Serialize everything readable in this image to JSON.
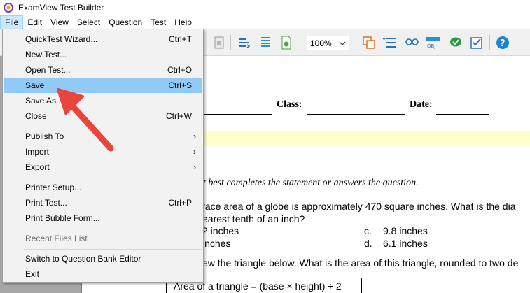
{
  "window": {
    "title": "ExamView Test Builder"
  },
  "menubar": {
    "items": [
      {
        "label": "File"
      },
      {
        "label": "Edit"
      },
      {
        "label": "View"
      },
      {
        "label": "Select"
      },
      {
        "label": "Question"
      },
      {
        "label": "Test"
      },
      {
        "label": "Help"
      }
    ]
  },
  "toolbar": {
    "zoom_value": "100%"
  },
  "file_menu": {
    "items": [
      {
        "label": "QuickTest Wizard...",
        "shortcut": "Ctrl+T"
      },
      {
        "label": "New Test...",
        "shortcut": ""
      },
      {
        "label": "Open Test...",
        "shortcut": "Ctrl+O"
      },
      {
        "label": "Save",
        "shortcut": "Ctrl+S"
      },
      {
        "label": "Save As...",
        "shortcut": ""
      },
      {
        "label": "Close",
        "shortcut": "Ctrl+W"
      },
      {
        "label": "Publish To",
        "shortcut": ""
      },
      {
        "label": "Import",
        "shortcut": ""
      },
      {
        "label": "Export",
        "shortcut": ""
      },
      {
        "label": "Printer Setup...",
        "shortcut": ""
      },
      {
        "label": "Print Test...",
        "shortcut": "Ctrl+P"
      },
      {
        "label": "Print Bubble Form...",
        "shortcut": ""
      },
      {
        "label": "Recent Files List",
        "shortcut": ""
      },
      {
        "label": "Switch to Question Bank Editor",
        "shortcut": ""
      },
      {
        "label": "Exit",
        "shortcut": ""
      }
    ],
    "submenu_arrow": "›"
  },
  "document": {
    "class_label": "Class:",
    "date_label": "Date:",
    "instructions": "at best completes the statement or answers the question.",
    "q1_line1": "face area of a globe is approximately 470 square inches. What is the dia",
    "q1_line2": "earest tenth of an inch?",
    "answers": {
      "a": "2 inches",
      "b": "inches",
      "c_letter": "c.",
      "c_text": "9.8 inches",
      "d_letter": "d.",
      "d_text": "6.1 inches"
    },
    "q2_text": "ew the triangle below. What is the area of this triangle, rounded to two de",
    "formula": "Area of a triangle = (base × height) ÷ 2"
  },
  "colors": {
    "menu_highlight": "#91c9f7",
    "annotation_arrow": "#e8453c",
    "highlight_band": "#ffffcc"
  }
}
